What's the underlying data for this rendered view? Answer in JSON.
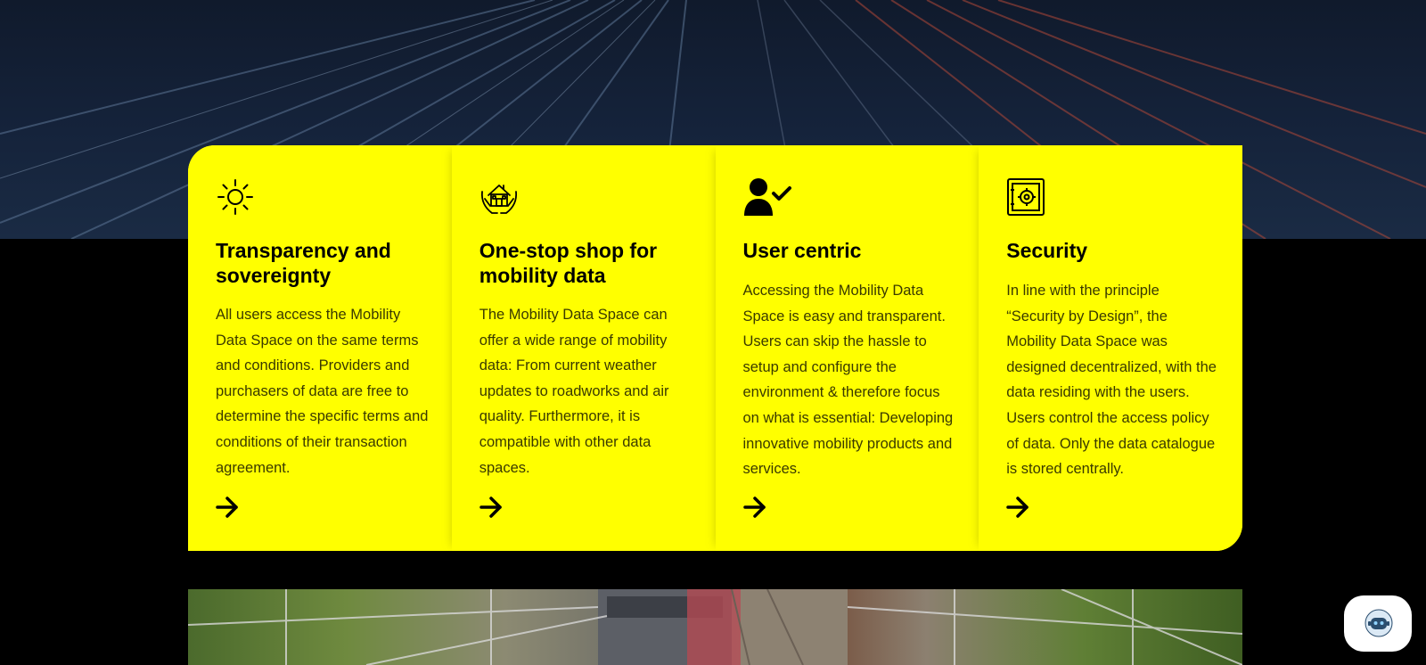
{
  "colors": {
    "card_bg": "#ffff00",
    "text": "#000000",
    "body_text": "#3a3a00",
    "page_bg": "#000000"
  },
  "cards": [
    {
      "icon": "sun-icon",
      "title": "Transparency and sovereignty",
      "text": "All users access the Mobility Data Space on the same terms and conditions. Providers and purchasers of data are free to determine the specific terms and conditions of their transaction agreement."
    },
    {
      "icon": "house-in-hands-icon",
      "title": "One-stop shop for mobility data",
      "text": "The Mobility Data Space can offer a wide range of mobility data: From current weather updates to roadworks and air quality. Furthermore, it is compatible with other data spaces."
    },
    {
      "icon": "user-check-icon",
      "title": "User centric",
      "text": "Accessing the Mobility Data Space is easy and transparent. Users can skip the hassle to setup and configure the environment & therefore focus on what is essential: Developing innovative mobility products and services."
    },
    {
      "icon": "safe-icon",
      "title": "Security",
      "text": "In line with the principle “Security by Design”, the Mobility Data Space was designed decentralized, with the data residing with the users. Users control the access policy of data. Only the data catalogue is stored centrally."
    }
  ],
  "chat_widget": {
    "icon": "chatbot-icon"
  }
}
